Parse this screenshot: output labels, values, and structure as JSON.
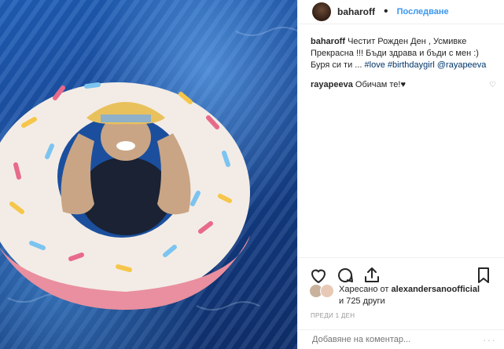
{
  "post": {
    "username": "baharoff",
    "follow_label": "Последване",
    "caption_user": "baharoff",
    "caption_text": "Честит Рожден Ден , Усмивке Прекрасна !!! Бъди здрава и бъди с мен :) Буря си ти ... ",
    "caption_tags": [
      "#love",
      "#birthdaygirl",
      "@rayapeeva"
    ],
    "reply_user": "rayapeeva",
    "reply_text": "Обичам те!♥",
    "likes_prefix": "Харесано от",
    "likes_user": "alexandersanoofficial",
    "likes_suffix": "и 725 други",
    "timestamp": "ПРЕДИ 1 ДЕН",
    "comment_placeholder": "Добавяне на коментар...",
    "more_label": "···"
  },
  "colors": {
    "link": "#3897f0",
    "text": "#262626",
    "muted": "#999999"
  },
  "icons": [
    "heart-icon",
    "comment-icon",
    "share-icon",
    "bookmark-icon"
  ]
}
